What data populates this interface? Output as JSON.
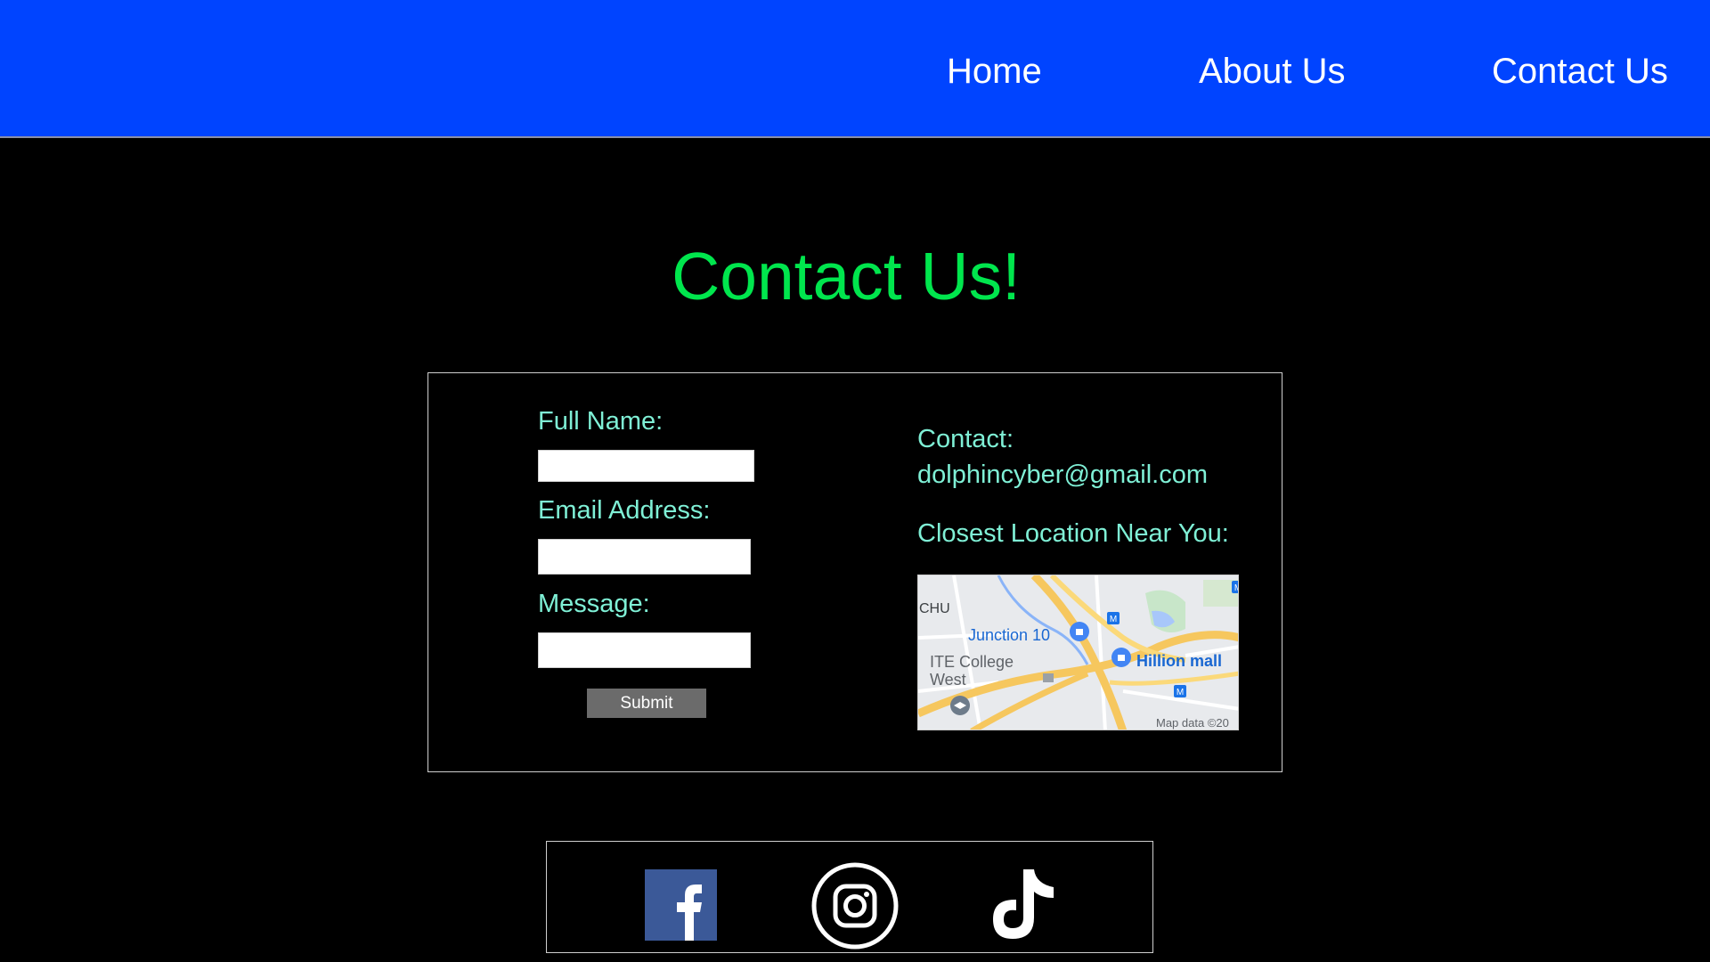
{
  "nav": {
    "home": "Home",
    "about": "About Us",
    "contact": "Contact Us"
  },
  "page": {
    "title": "Contact Us!"
  },
  "form": {
    "full_name_label": "Full Name:",
    "full_name_value": "",
    "email_label": "Email Address:",
    "email_value": "",
    "message_label": "Message:",
    "message_value": "",
    "submit_label": "Submit"
  },
  "info": {
    "contact_label": "Contact:",
    "email": "dolphincyber@gmail.com",
    "location_label": "Closest Location Near You:"
  },
  "map": {
    "labels": {
      "junction": "Junction 10",
      "college_line1": "ITE College",
      "college_line2": "West",
      "mall": "Hillion mall",
      "district_fragment": "CHU",
      "attribution": "Map data ©20"
    },
    "metro_glyph": "M"
  },
  "social": {
    "icons": [
      "facebook-icon",
      "instagram-icon",
      "tiktok-icon"
    ]
  },
  "colors": {
    "header_bg": "#0044ff",
    "title_green": "#00e64d",
    "label_teal": "#7ff0d6",
    "submit_bg": "#6b6b6b",
    "facebook_blue": "#3b5998"
  }
}
